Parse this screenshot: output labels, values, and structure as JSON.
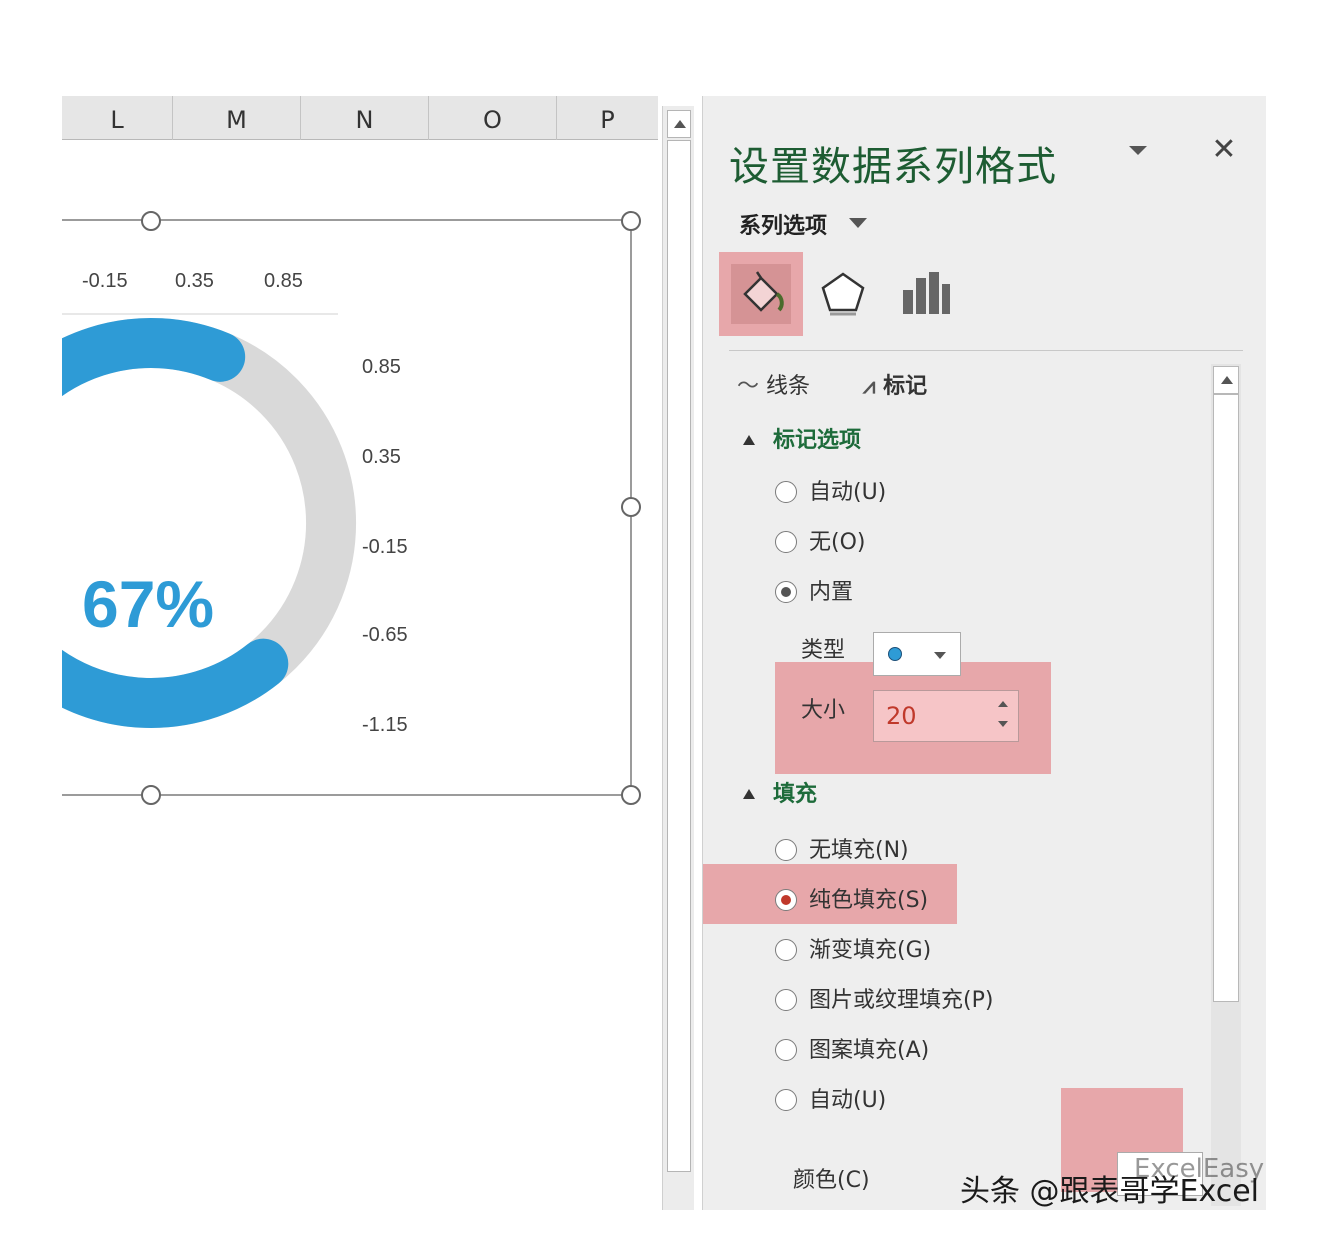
{
  "sheet": {
    "columns": [
      "L",
      "M",
      "N",
      "O",
      "P"
    ]
  },
  "chart": {
    "center_label": "67%",
    "percent_value": 0.67,
    "top_axis_ticks": [
      "-0.15",
      "0.35",
      "0.85"
    ],
    "right_axis_ticks": [
      "0.85",
      "0.35",
      "-0.15",
      "-0.65",
      "-1.15"
    ],
    "colors": {
      "progress": "#2e9bd6",
      "track": "#d9d9d9"
    }
  },
  "pane": {
    "title": "设置数据系列格式",
    "close_icon": "close-icon",
    "series_options": "系列选项",
    "icons": [
      "fill-line-icon",
      "effects-pentagon-icon",
      "series-options-bars-icon"
    ],
    "subtabs": {
      "line": "线条",
      "marker": "标记"
    },
    "marker_options": {
      "heading": "标记选项",
      "auto": "自动(U)",
      "none": "无(O)",
      "builtin": "内置",
      "type_label": "类型",
      "size_label": "大小",
      "size_value": "20"
    },
    "fill": {
      "heading": "填充",
      "no_fill": "无填充(N)",
      "solid": "纯色填充(S)",
      "gradient": "渐变填充(G)",
      "picture": "图片或纹理填充(P)",
      "pattern": "图案填充(A)",
      "auto": "自动(U)",
      "color_label": "颜色(C)"
    },
    "highlight_color": "#e7a7aa"
  },
  "watermark": {
    "text": "头条 @跟表哥学Excel",
    "overlay": "ExcelEasy"
  }
}
